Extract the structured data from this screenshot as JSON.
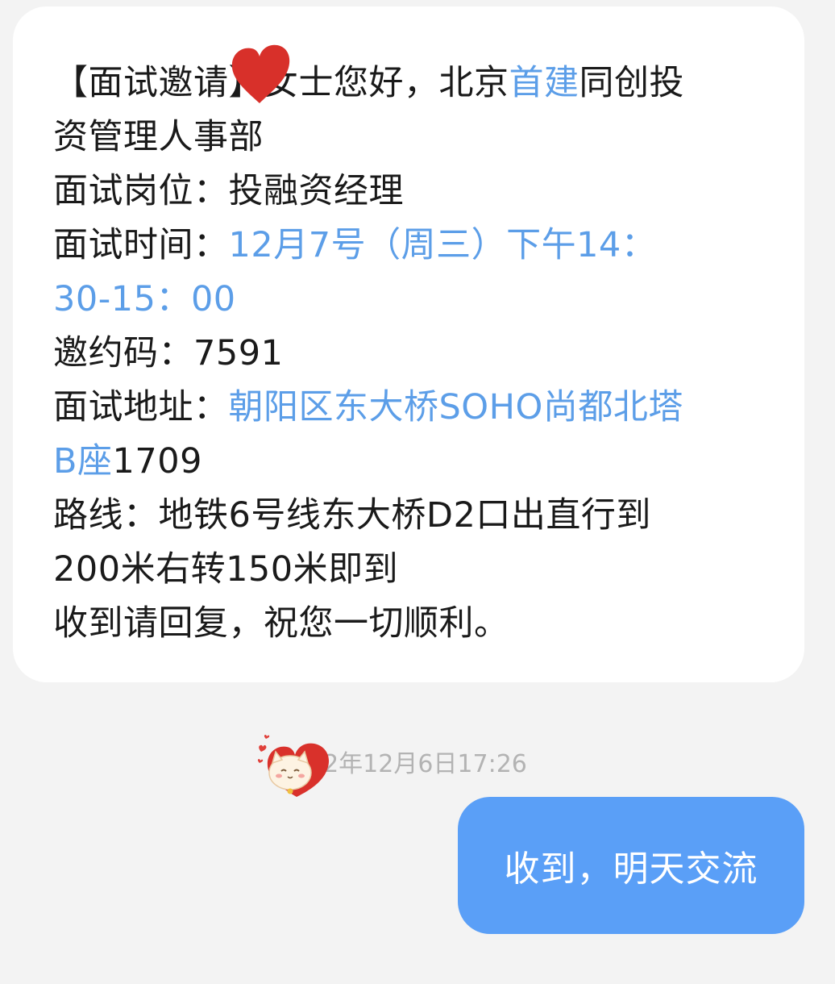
{
  "message_in": {
    "line1": {
      "a": "【面试邀请】",
      "b": "女士您好，北京",
      "c": "首建",
      "d": "同创投"
    },
    "line2": "资管理人事部",
    "line3": "面试岗位：投融资经理",
    "line4": {
      "label": "面试时间：",
      "value": "12月7号（周三）下午14："
    },
    "line5": "30-15：00",
    "line6": "邀约码：7591",
    "line7": {
      "label": "面试地址：",
      "value": "朝阳区东大桥SOHO尚都北塔"
    },
    "line8": {
      "link": "B座",
      "rest": "1709"
    },
    "line9": "路线：地铁6号线东大桥D2口出直行到",
    "line10": "200米右转150米即到",
    "line11": "收到请回复，祝您一切顺利。"
  },
  "timestamp": "22年12月6日17:26",
  "message_out": {
    "text": "收到，明天交流"
  },
  "colors": {
    "background": "#f3f3f3",
    "incoming_bubble": "#ffffff",
    "outgoing_bubble": "#5a9ff7",
    "link": "#5c9ee8",
    "sticker_heart": "#d8302a"
  },
  "icons": {
    "sticker_1": "red-heart-sticker",
    "sticker_2": "cat-heart-sticker"
  }
}
